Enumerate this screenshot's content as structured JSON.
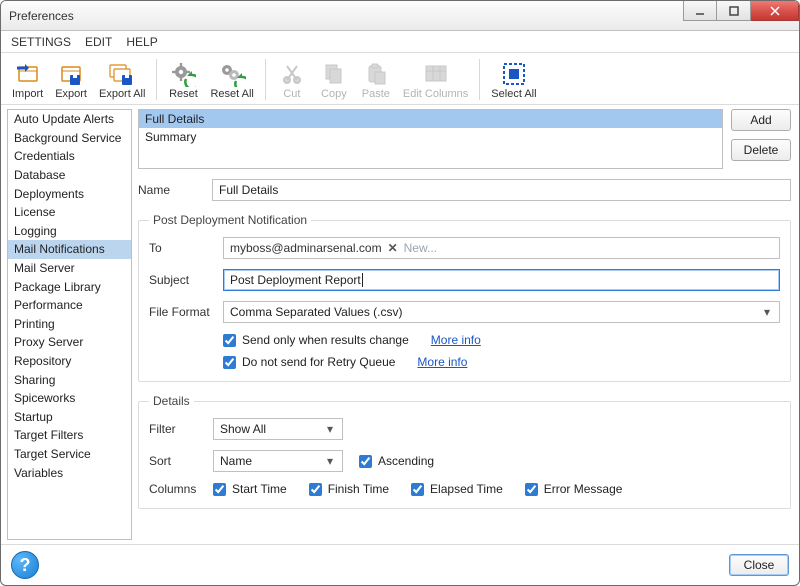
{
  "window": {
    "title": "Preferences"
  },
  "menu": {
    "settings": "SETTINGS",
    "edit": "EDIT",
    "help": "HELP"
  },
  "toolbar": {
    "import": "Import",
    "export": "Export",
    "export_all": "Export All",
    "reset": "Reset",
    "reset_all": "Reset All",
    "cut": "Cut",
    "copy": "Copy",
    "paste": "Paste",
    "edit_columns": "Edit Columns",
    "select_all": "Select All"
  },
  "sidebar": {
    "items": [
      "Auto Update Alerts",
      "Background Service",
      "Credentials",
      "Database",
      "Deployments",
      "License",
      "Logging",
      "Mail Notifications",
      "Mail Server",
      "Package Library",
      "Performance",
      "Printing",
      "Proxy Server",
      "Repository",
      "Sharing",
      "Spiceworks",
      "Startup",
      "Target Filters",
      "Target Service",
      "Variables"
    ],
    "selected_index": 7
  },
  "list": {
    "items": [
      "Full Details",
      "Summary"
    ],
    "selected_index": 0,
    "add_label": "Add",
    "delete_label": "Delete"
  },
  "name": {
    "label": "Name",
    "value": "Full Details"
  },
  "post": {
    "legend": "Post Deployment Notification",
    "to_label": "To",
    "to_token": "myboss@adminarsenal.com",
    "to_placeholder": "New...",
    "subject_label": "Subject",
    "subject_value": "Post Deployment Report",
    "file_format_label": "File Format",
    "file_format_value": "Comma Separated Values (.csv)",
    "chk1_label": "Send only when results change",
    "chk2_label": "Do not send for Retry Queue",
    "more_info": "More info"
  },
  "details": {
    "legend": "Details",
    "filter_label": "Filter",
    "filter_value": "Show All",
    "sort_label": "Sort",
    "sort_value": "Name",
    "ascending_label": "Ascending",
    "columns_label": "Columns",
    "col1": "Start Time",
    "col2": "Finish Time",
    "col3": "Elapsed Time",
    "col4": "Error Message"
  },
  "footer": {
    "close": "Close"
  },
  "colors": {
    "accent": "#2d7bd3",
    "selection": "#a3c8ef",
    "sidebar_selection": "#bcd5ee"
  }
}
